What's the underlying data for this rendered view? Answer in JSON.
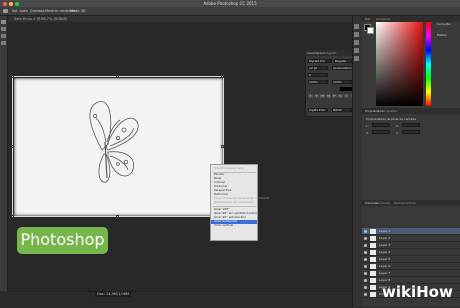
{
  "app": {
    "window_title": "Adobe Photoshop CC 2015",
    "document_tab": "Sem título-1 @ 66,7% (RGB/8)"
  },
  "options_bar": {
    "items": [
      "Sel. Auto",
      "Camada",
      "Mostrar controles",
      "Modo 3D"
    ]
  },
  "status_bar": {
    "text": "Doc: 24,9M/1,06M"
  },
  "context_menu": {
    "items": [
      {
        "label": "Transformação livre",
        "state": "disabled"
      },
      {
        "label": "Escala",
        "state": "normal"
      },
      {
        "label": "Girar",
        "state": "normal"
      },
      {
        "label": "Inclinar",
        "state": "normal"
      },
      {
        "label": "Distorcer",
        "state": "normal"
      },
      {
        "label": "Perspectiva",
        "state": "normal"
      },
      {
        "label": "Deformar",
        "state": "normal"
      },
      {
        "label": "Preenchimento sensível ao conteúdo",
        "state": "disabled"
      },
      {
        "label": "Deformação de marionete",
        "state": "disabled"
      },
      {
        "label": "Girar 180°",
        "state": "normal"
      },
      {
        "label": "Girar 90° em sentido horário",
        "state": "normal"
      },
      {
        "label": "Girar 90° anti-horário",
        "state": "normal"
      },
      {
        "label": "Virar horizontal",
        "state": "selected"
      },
      {
        "label": "Virar vertical",
        "state": "normal"
      }
    ]
  },
  "character_panel": {
    "tabs": [
      "Caractere",
      "Parágrafo"
    ],
    "font_family": "Myriad Pro",
    "font_style": "Regular",
    "font_size": "12 pt",
    "leading": "(Automático)",
    "tracking": "0",
    "scale_v": "100%",
    "scale_h": "100%",
    "language": "Inglês EUA",
    "antialias": "Nítido",
    "type_styles": [
      "T",
      "T",
      "TT",
      "Tt",
      "T¹",
      "T₁",
      "T",
      "T"
    ]
  },
  "color_panel": {
    "tabs": [
      "Cor",
      "Amostras"
    ],
    "foreground": "#111111",
    "background": "#ffffff",
    "accent_red": "#e81010"
  },
  "side_mini": {
    "items": [
      "Correção",
      "Estilos"
    ]
  },
  "properties_panel": {
    "tabs": [
      "Propriedades",
      "Ajustes"
    ],
    "title": "Propriedades de pixel de camada",
    "fields": [
      "L:",
      "A:",
      "X:",
      "Y:"
    ]
  },
  "layers_panel": {
    "tabs": [
      "Camadas",
      "Canais",
      "Demarcadores"
    ],
    "rows": [
      {
        "name": "Layer 1"
      },
      {
        "name": "Layer 2"
      },
      {
        "name": "Layer 3"
      },
      {
        "name": "Layer 4"
      },
      {
        "name": "Layer 5"
      },
      {
        "name": "Layer 6"
      },
      {
        "name": "Layer 7"
      },
      {
        "name": "Layer 8"
      },
      {
        "name": "Layer 9"
      },
      {
        "name": "Fundo"
      }
    ]
  },
  "overlay": {
    "badge_text": "Photoshop",
    "badge_color": "#76b64a",
    "watermark_wiki": "wiki",
    "watermark_how": "How"
  }
}
